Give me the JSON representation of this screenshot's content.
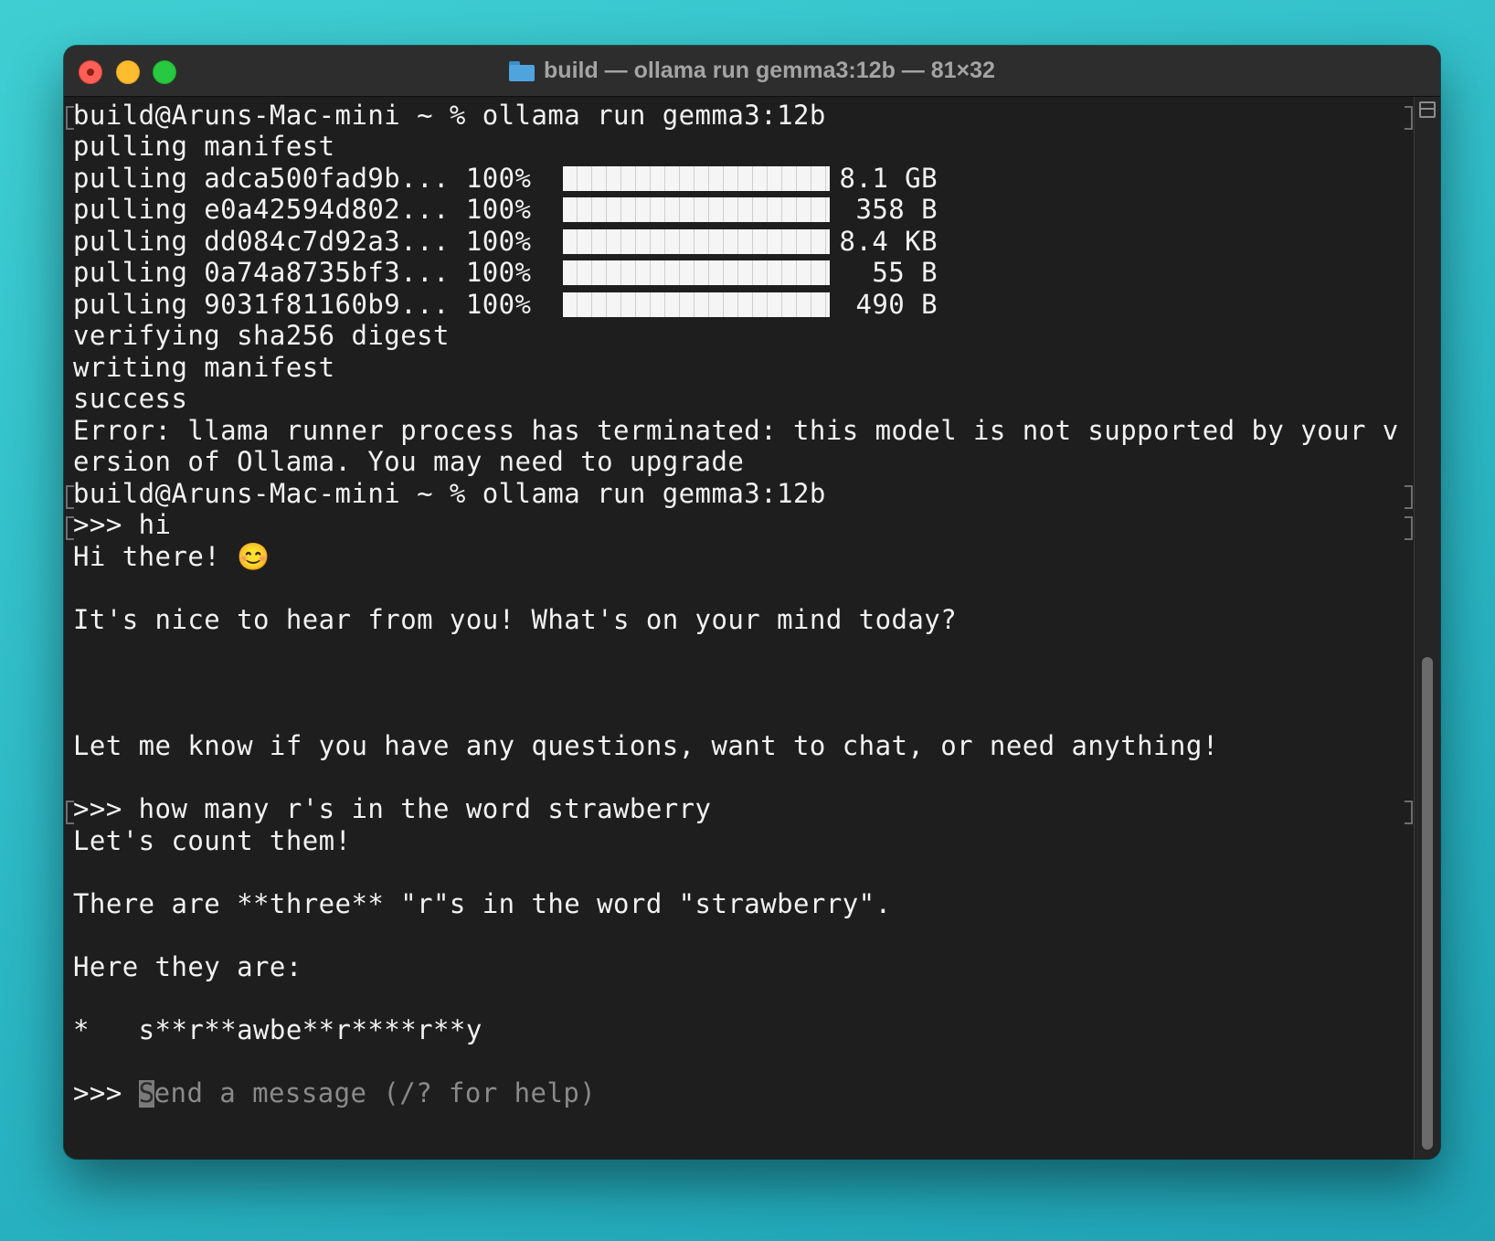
{
  "window": {
    "title": "build — ollama run gemma3:12b — 81×32",
    "scrollbar_position": 0.52,
    "scrollbar_visible_fraction": 0.48
  },
  "terminal": {
    "prompt1": "build@Aruns-Mac-mini ~ % ollama run gemma3:12b",
    "pulling_manifest": "pulling manifest",
    "downloads": [
      {
        "label": "pulling adca500fad9b... 100%",
        "size": "8.1 GB",
        "progress": 1.0
      },
      {
        "label": "pulling e0a42594d802... 100%",
        "size": "358 B",
        "progress": 1.0
      },
      {
        "label": "pulling dd084c7d92a3... 100%",
        "size": "8.4 KB",
        "progress": 1.0
      },
      {
        "label": "pulling 0a74a8735bf3... 100%",
        "size": "55 B",
        "progress": 1.0
      },
      {
        "label": "pulling 9031f81160b9... 100%",
        "size": "490 B",
        "progress": 1.0
      }
    ],
    "verifying": "verifying sha256 digest",
    "writing": "writing manifest",
    "success": "success",
    "error_line1": "Error: llama runner process has terminated: this model is not supported by your v",
    "error_line2": "ersion of Ollama. You may need to upgrade",
    "prompt2": "build@Aruns-Mac-mini ~ % ollama run gemma3:12b",
    "input1": ">>> hi",
    "reply1_line1": "Hi there! 😊",
    "reply1_line2": "It's nice to hear from you! What's on your mind today?",
    "reply1_line3": "Let me know if you have any questions, want to chat, or need anything!",
    "input2": ">>> how many r's in the word strawberry",
    "reply2_line1": "Let's count them!",
    "reply2_line2": "There are **three** \"r\"s in the word \"strawberry\".",
    "reply2_line3": "Here they are:",
    "reply2_line4": "*   s**r**awbe**r****r**y",
    "input_prompt": ">>> ",
    "input_placeholder_first": "S",
    "input_placeholder_rest": "end a message (/? for help)"
  }
}
